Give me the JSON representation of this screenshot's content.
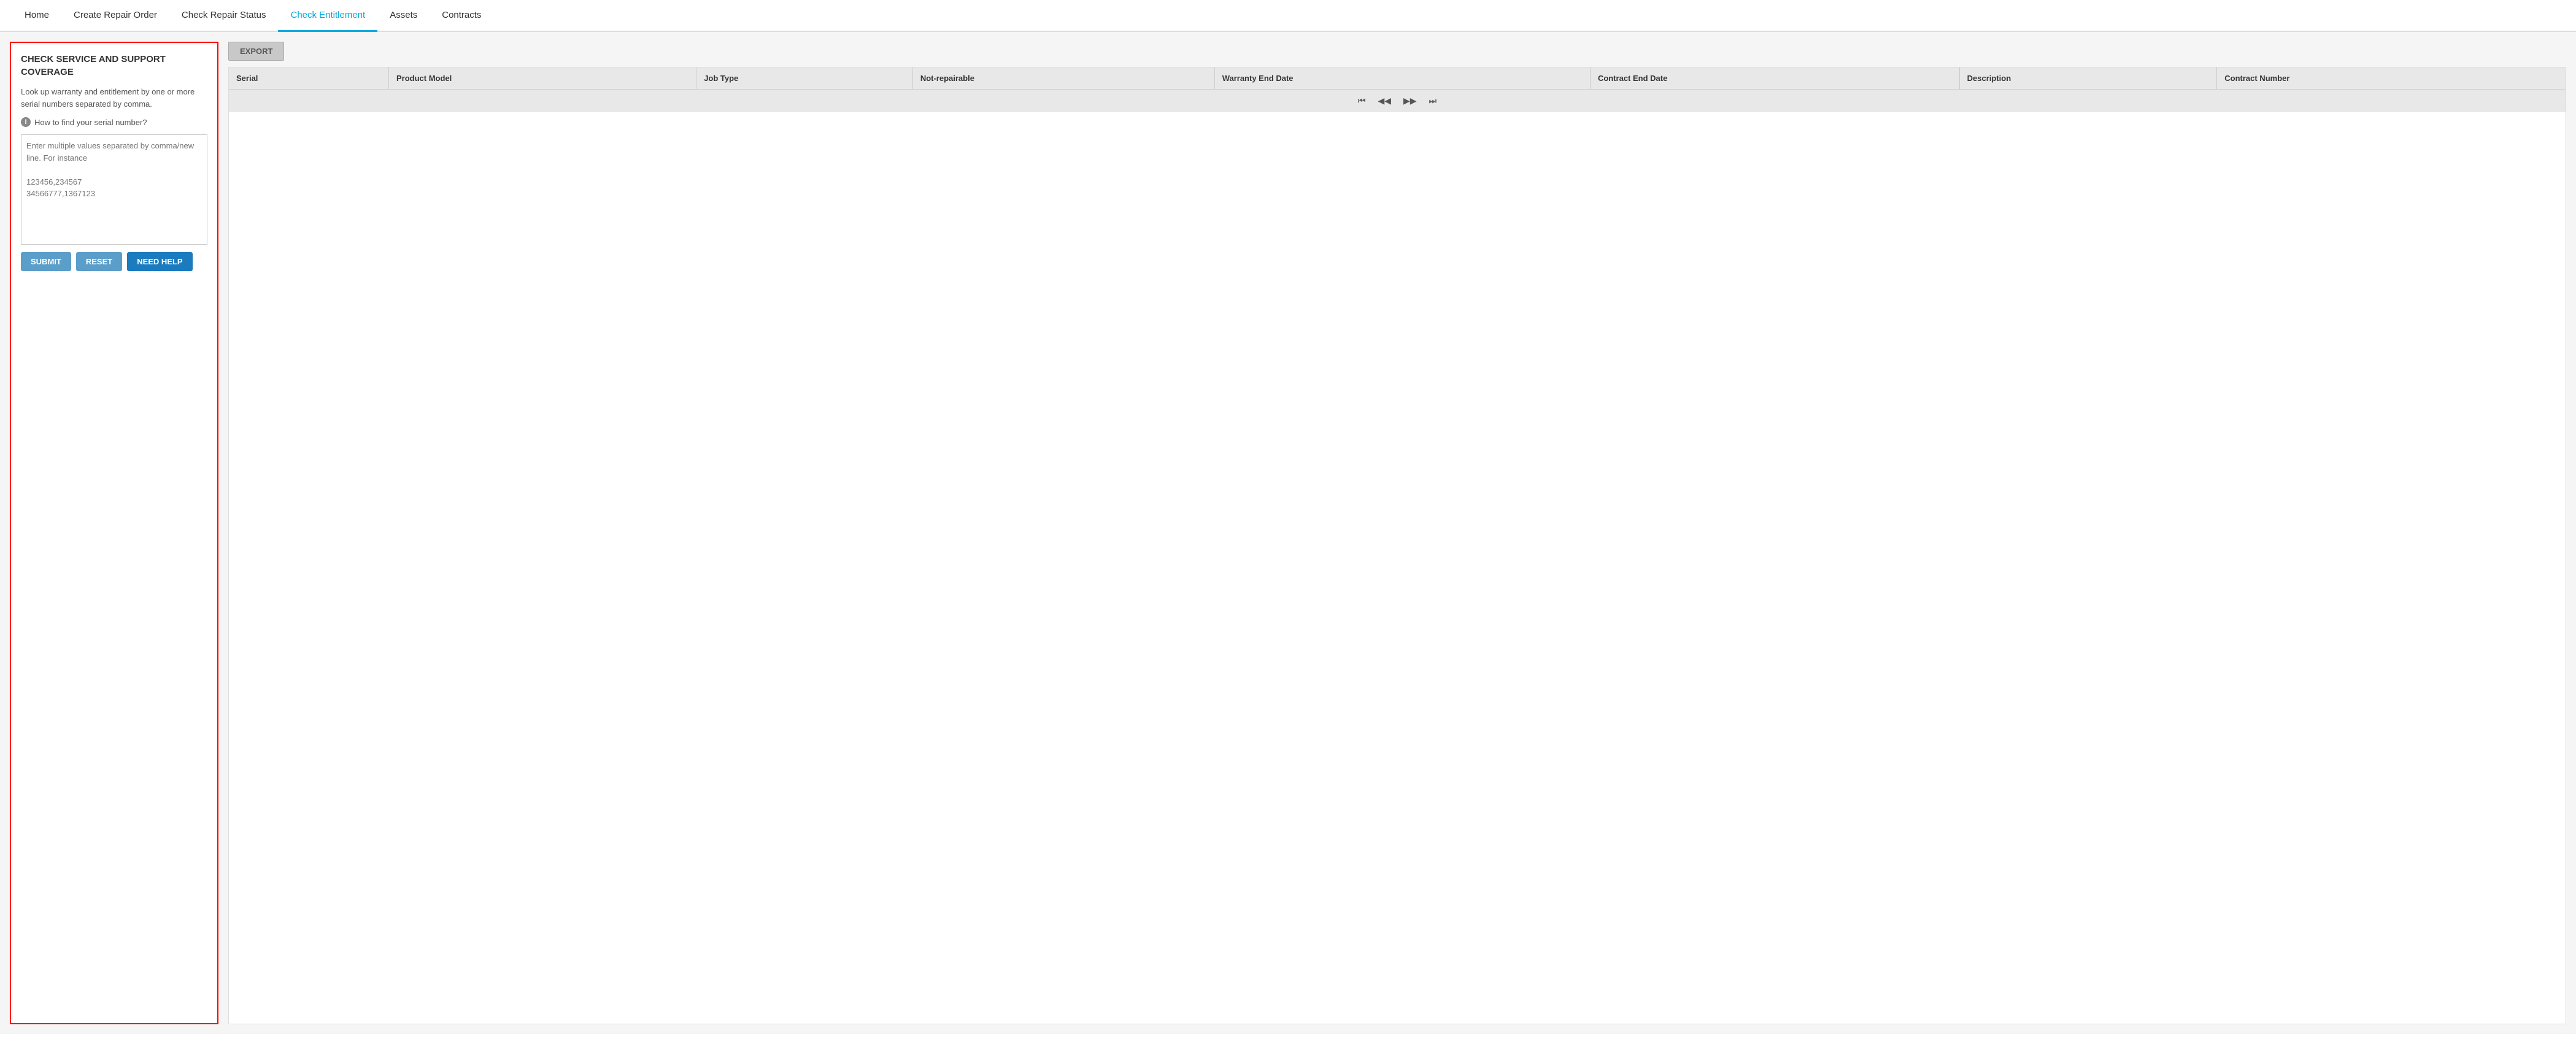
{
  "nav": {
    "items": [
      {
        "id": "home",
        "label": "Home",
        "active": false
      },
      {
        "id": "create-repair-order",
        "label": "Create Repair Order",
        "active": false
      },
      {
        "id": "check-repair-status",
        "label": "Check Repair Status",
        "active": false
      },
      {
        "id": "check-entitlement",
        "label": "Check Entitlement",
        "active": true
      },
      {
        "id": "assets",
        "label": "Assets",
        "active": false
      },
      {
        "id": "contracts",
        "label": "Contracts",
        "active": false
      }
    ]
  },
  "left_panel": {
    "title": "CHECK SERVICE AND SUPPORT COVERAGE",
    "description": "Look up warranty and entitlement by one or more serial numbers separated by comma.",
    "help_link": "How to find your serial number?",
    "textarea_placeholder": "Enter multiple values separated by comma/new line. For instance\n\n123456,234567\n34566777,1367123",
    "buttons": {
      "submit": "SUBMIT",
      "reset": "RESET",
      "need_help": "NEED HELP"
    }
  },
  "table": {
    "export_label": "EXPORT",
    "columns": [
      {
        "id": "serial",
        "label": "Serial"
      },
      {
        "id": "product-model",
        "label": "Product Model"
      },
      {
        "id": "job-type",
        "label": "Job Type"
      },
      {
        "id": "not-repairable",
        "label": "Not-repairable"
      },
      {
        "id": "warranty-end-date",
        "label": "Warranty End Date"
      },
      {
        "id": "contract-end-date",
        "label": "Contract End Date"
      },
      {
        "id": "description",
        "label": "Description"
      },
      {
        "id": "contract-number",
        "label": "Contract Number"
      }
    ],
    "rows": []
  },
  "pagination": {
    "first": "⏮",
    "prev": "◀",
    "next": "▶",
    "last": "⏭"
  }
}
